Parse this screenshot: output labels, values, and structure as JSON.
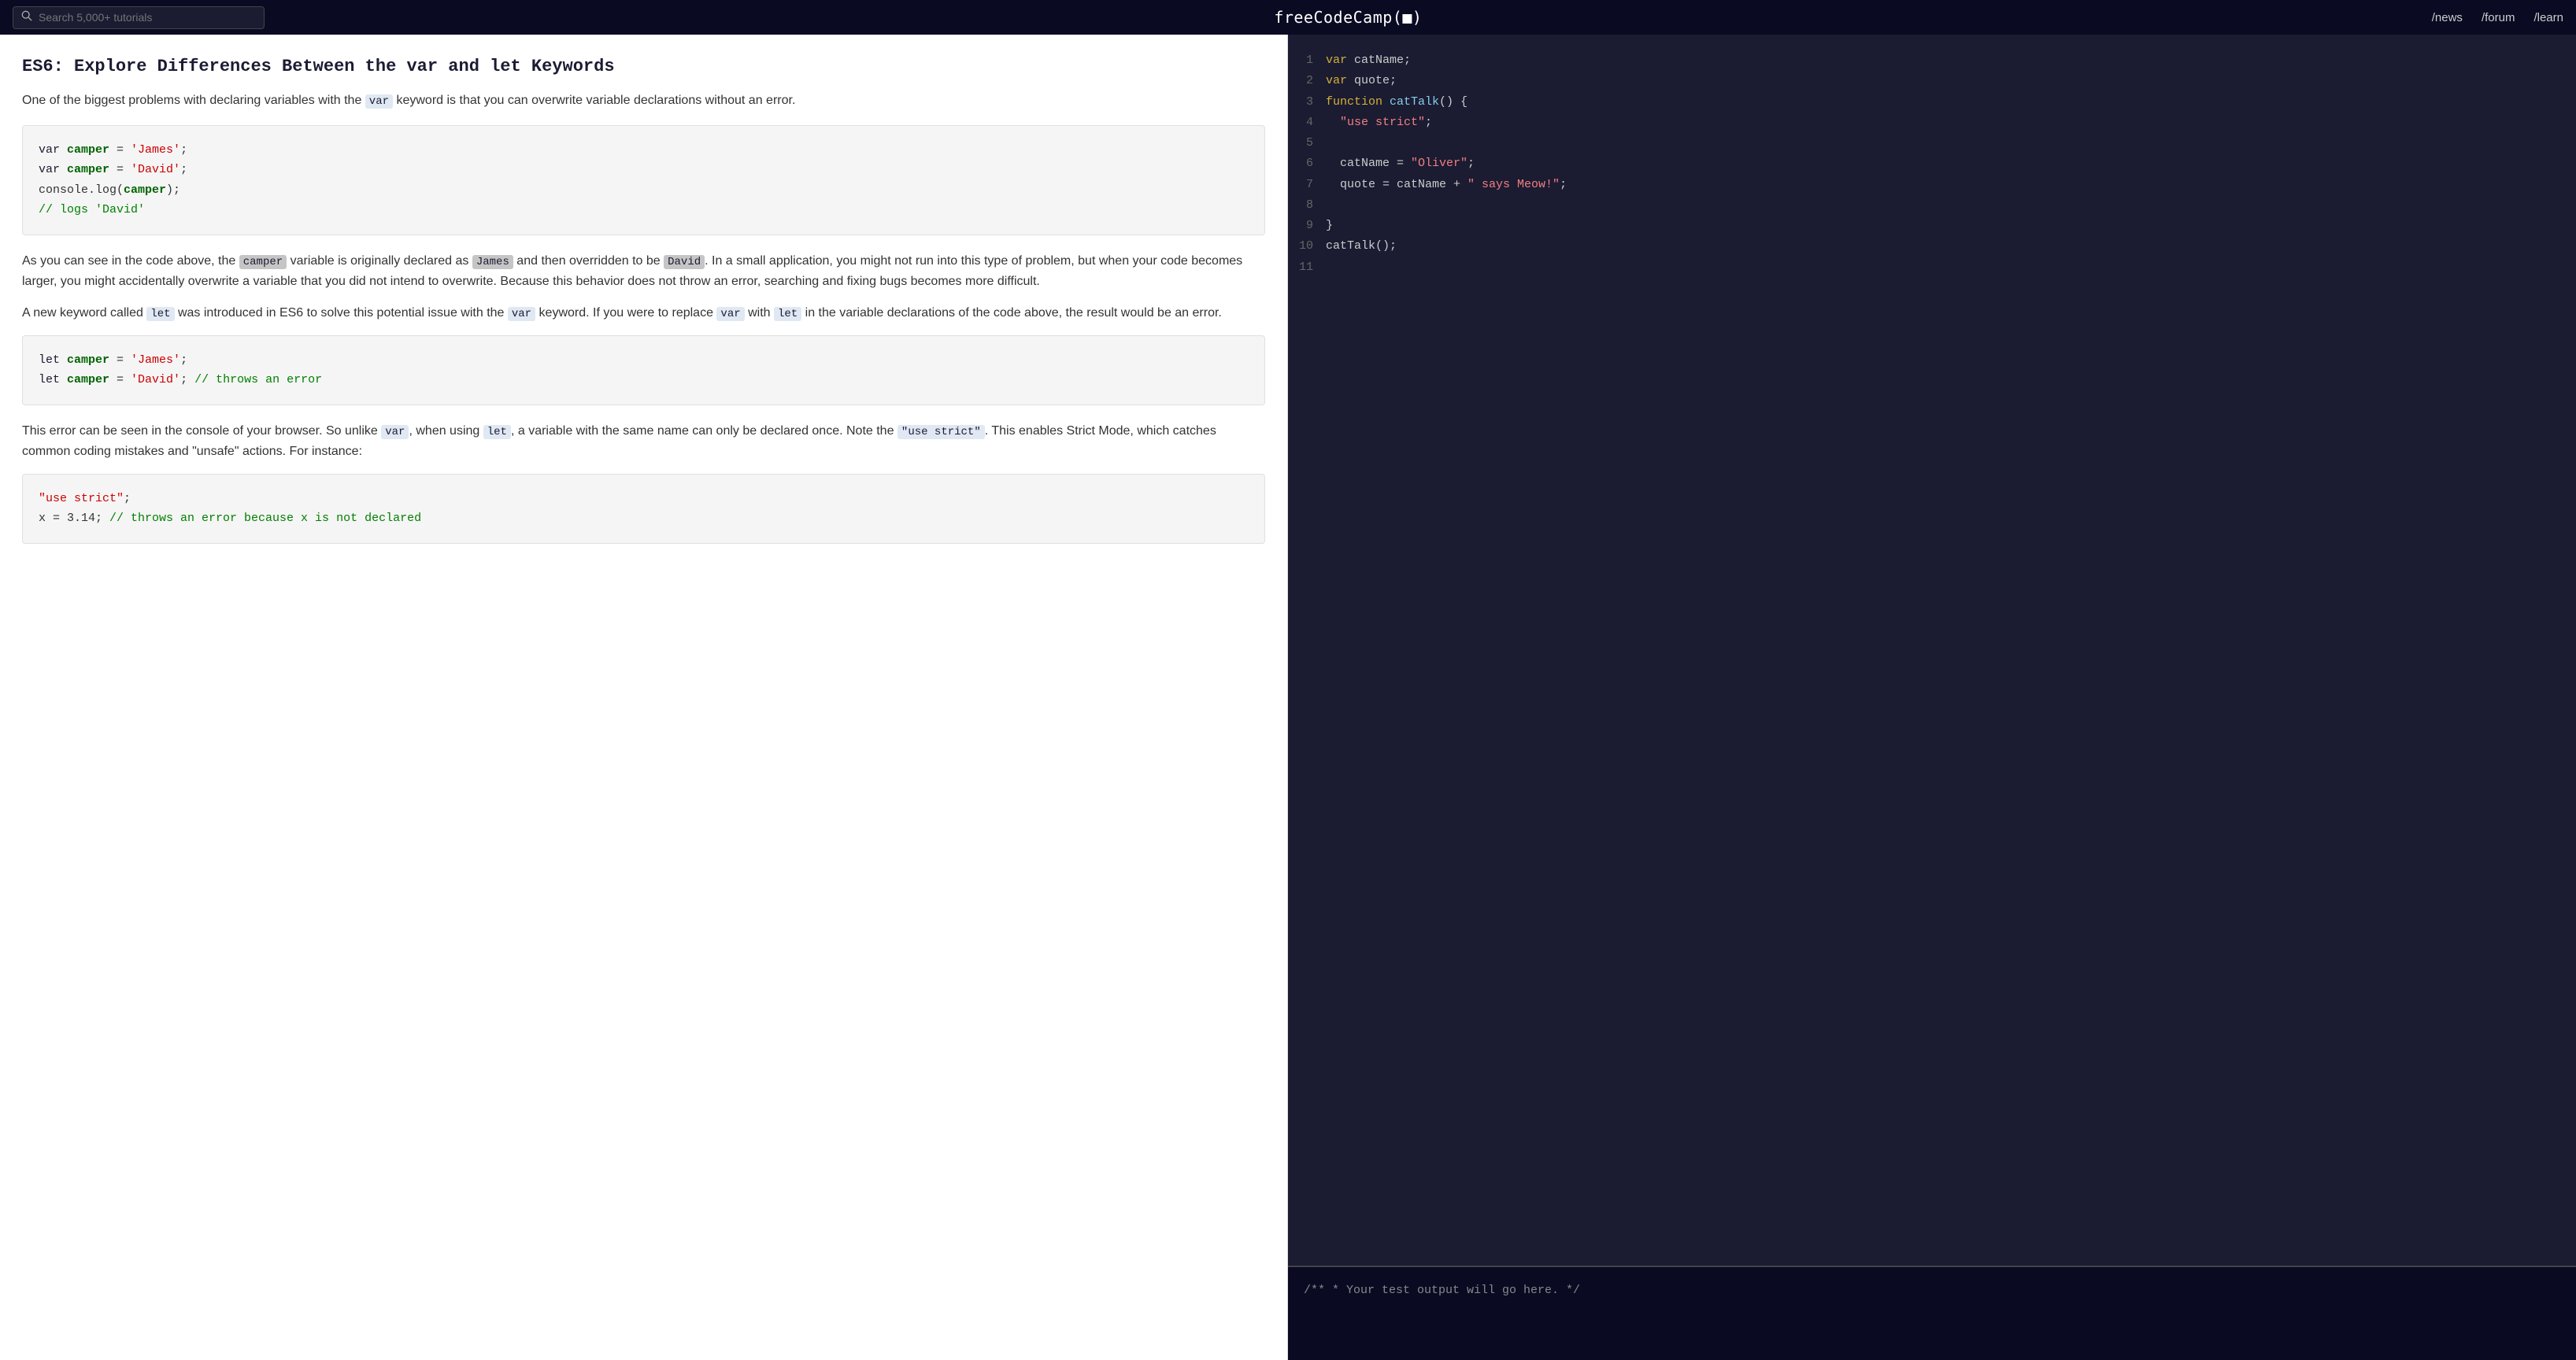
{
  "header": {
    "search_placeholder": "Search 5,000+ tutorials",
    "brand": "freeCodeCamp(■)",
    "nav": [
      "/news",
      "/forum",
      "/learn"
    ]
  },
  "left": {
    "title": "ES6: Explore Differences Between the var and let Keywords",
    "intro": "One of the biggest problems with declaring variables with the",
    "intro_code": "var",
    "intro_rest": "keyword is that you can overwrite variable declarations without an error.",
    "code_block_1": {
      "lines": [
        {
          "parts": [
            {
              "type": "kw",
              "text": "var "
            },
            {
              "type": "var",
              "text": "camper"
            },
            {
              "type": "plain",
              "text": " = "
            },
            {
              "type": "str",
              "text": "'James'"
            },
            {
              "type": "plain",
              "text": ";"
            }
          ]
        },
        {
          "parts": [
            {
              "type": "kw",
              "text": "var "
            },
            {
              "type": "var",
              "text": "camper"
            },
            {
              "type": "plain",
              "text": " = "
            },
            {
              "type": "str",
              "text": "'David'"
            },
            {
              "type": "plain",
              "text": ";"
            }
          ]
        },
        {
          "parts": [
            {
              "type": "plain",
              "text": "console"
            },
            {
              "type": "plain",
              "text": ".log("
            },
            {
              "type": "var",
              "text": "camper"
            },
            {
              "type": "plain",
              "text": ");"
            }
          ]
        },
        {
          "parts": [
            {
              "type": "comment",
              "text": "// logs 'David'"
            }
          ]
        }
      ]
    },
    "body_1": "As you can see in the code above, the",
    "body_1_code1": "camper",
    "body_1_mid1": "variable is originally declared as",
    "body_1_code2": "James",
    "body_1_end1": "and then overridden to be",
    "body_1_code3": "David",
    "body_1_end2": ". In a small application, you might not run into this type of problem, but when your code becomes larger, you might accidentally overwrite a variable that you did not intend to overwrite. Because this behavior does not throw an error, searching and fixing bugs becomes more difficult.",
    "body_2_start": "A new keyword called",
    "body_2_code1": "let",
    "body_2_mid": "was introduced in ES6 to solve this potential issue with the",
    "body_2_code2": "var",
    "body_2_end": "keyword. If you were to replace",
    "body_2_code3": "var",
    "body_2_with": "with",
    "body_2_code4": "let",
    "body_2_rest": "in the variable declarations of the code above, the result would be an error.",
    "code_block_2": {
      "lines": [
        {
          "parts": [
            {
              "type": "kw",
              "text": "let "
            },
            {
              "type": "var",
              "text": "camper"
            },
            {
              "type": "plain",
              "text": " = "
            },
            {
              "type": "str",
              "text": "'James'"
            },
            {
              "type": "plain",
              "text": ";"
            }
          ]
        },
        {
          "parts": [
            {
              "type": "kw",
              "text": "let "
            },
            {
              "type": "var",
              "text": "camper"
            },
            {
              "type": "plain",
              "text": " = "
            },
            {
              "type": "str",
              "text": "'David'"
            },
            {
              "type": "plain",
              "text": "; "
            },
            {
              "type": "comment",
              "text": "// throws an error"
            }
          ]
        }
      ]
    },
    "body_3": "This error can be seen in the console of your browser. So unlike",
    "body_3_code1": "var",
    "body_3_mid1": ", when using",
    "body_3_code2": "let",
    "body_3_mid2": ", a variable with the same name can only be declared once. Note the",
    "body_3_code3": "\"use strict\"",
    "body_3_end": ". This enables Strict Mode, which catches common coding mistakes and \"unsafe\" actions. For instance:",
    "code_block_3": {
      "lines": [
        {
          "parts": [
            {
              "type": "str",
              "text": "\"use strict\""
            },
            {
              "type": "plain",
              "text": ";"
            }
          ]
        },
        {
          "parts": [
            {
              "type": "plain",
              "text": "x = 3.14; "
            },
            {
              "type": "comment",
              "text": "// throws an error because x is not declared"
            }
          ]
        }
      ]
    }
  },
  "right": {
    "editor_lines": [
      {
        "num": 1,
        "tokens": [
          {
            "t": "kw",
            "v": "var "
          },
          {
            "t": "plain",
            "v": "catName;"
          }
        ]
      },
      {
        "num": 2,
        "tokens": [
          {
            "t": "kw",
            "v": "var "
          },
          {
            "t": "plain",
            "v": "quote;"
          }
        ]
      },
      {
        "num": 3,
        "tokens": [
          {
            "t": "kw",
            "v": "function "
          },
          {
            "t": "fn",
            "v": "catTalk"
          },
          {
            "t": "plain",
            "v": "() {"
          }
        ]
      },
      {
        "num": 4,
        "tokens": [
          {
            "t": "plain",
            "v": "  "
          },
          {
            "t": "str",
            "v": "\"use strict\""
          },
          {
            "t": "plain",
            "v": ";"
          }
        ]
      },
      {
        "num": 5,
        "tokens": []
      },
      {
        "num": 6,
        "tokens": [
          {
            "t": "plain",
            "v": "  catName = "
          },
          {
            "t": "str",
            "v": "\"Oliver\""
          },
          {
            "t": "plain",
            "v": ";"
          }
        ]
      },
      {
        "num": 7,
        "tokens": [
          {
            "t": "plain",
            "v": "  quote = catName + "
          },
          {
            "t": "str",
            "v": "\" says Meow!\""
          },
          {
            "t": "plain",
            "v": ";"
          }
        ]
      },
      {
        "num": 8,
        "tokens": []
      },
      {
        "num": 9,
        "tokens": [
          {
            "t": "plain",
            "v": "}"
          }
        ]
      },
      {
        "num": 10,
        "tokens": [
          {
            "t": "plain",
            "v": "catTalk();"
          }
        ]
      },
      {
        "num": 11,
        "tokens": []
      }
    ],
    "output": "/**\n * Your test output will go here.\n */"
  }
}
